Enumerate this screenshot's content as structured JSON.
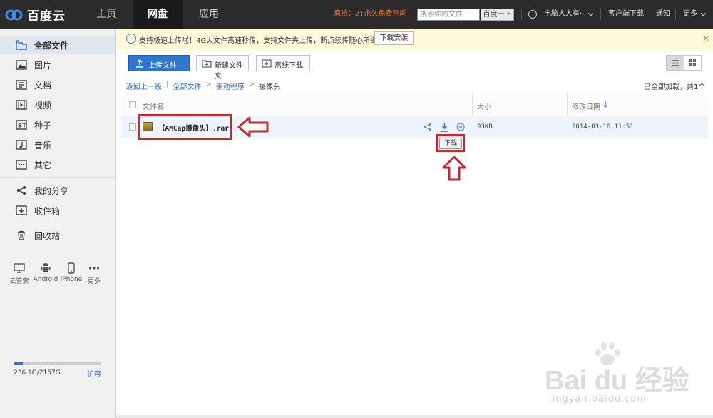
{
  "brand": {
    "name": "百度云"
  },
  "nav": [
    {
      "label": "主页"
    },
    {
      "label": "网盘"
    },
    {
      "label": "应用"
    }
  ],
  "promo": "疯抢：2T永久免费空间",
  "search": {
    "placeholder": "搜索你的文件",
    "button": "百度一下"
  },
  "user": {
    "name": "电脑人人有··"
  },
  "top_links": {
    "client": "客户端下载",
    "notify": "通知",
    "more": "更多"
  },
  "sidebar": {
    "items": [
      {
        "label": "全部文件",
        "icon": "folder-icon"
      },
      {
        "label": "图片",
        "icon": "image-icon"
      },
      {
        "label": "文档",
        "icon": "document-icon"
      },
      {
        "label": "视频",
        "icon": "video-icon"
      },
      {
        "label": "种子",
        "icon": "bt-icon"
      },
      {
        "label": "音乐",
        "icon": "music-icon"
      },
      {
        "label": "其它",
        "icon": "more-icon"
      },
      {
        "label": "我的分享",
        "icon": "share-icon"
      },
      {
        "label": "收件箱",
        "icon": "inbox-icon"
      },
      {
        "label": "回收站",
        "icon": "trash-icon"
      }
    ],
    "devices": [
      {
        "label": "云管家",
        "icon": "monitor-icon"
      },
      {
        "label": "Android",
        "icon": "android-icon"
      },
      {
        "label": "iPhone",
        "icon": "phone-icon"
      },
      {
        "label": "更多",
        "icon": "dots-icon"
      }
    ],
    "quota": {
      "text": "236.1G/2157G",
      "used_fraction": 0.11,
      "expand": "扩容"
    }
  },
  "notice": {
    "text": "支持极速上传啦！4G大文件高速秒传，支持文件夹上传，断点续传随心所欲！",
    "button": "下载安装"
  },
  "toolbar": {
    "upload": "上传文件",
    "new_folder": "新建文件夹",
    "offline": "离线下载"
  },
  "breadcrumb": {
    "back": "返回上一级",
    "items": [
      "全部文件",
      "驱动程序",
      "摄像头"
    ]
  },
  "count": "已全部加载，共1个",
  "table": {
    "headers": {
      "name": "文件名",
      "size": "大小",
      "date": "修改日期"
    },
    "rows": [
      {
        "name": "【AMCap摄像头】.rar",
        "size": "93KB",
        "date": "2014-03-16 11:51"
      }
    ]
  },
  "tooltip": "下载",
  "watermark": {
    "big": "Bai du 经验",
    "url": "jingyan.baidu.com"
  },
  "colors": {
    "accent": "#2e76d0",
    "annotation": "#c12a2f",
    "topbar": "#2b2b2b"
  }
}
